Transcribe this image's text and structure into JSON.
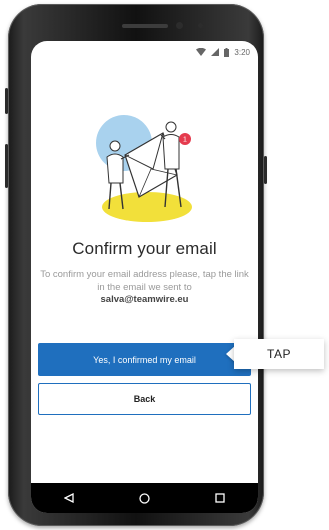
{
  "status_bar": {
    "time": "3:20"
  },
  "confirm_screen": {
    "title": "Confirm your email",
    "instructions": "To confirm your email address please, tap the link in the email we sent to",
    "email": "salva@teamwire.eu",
    "confirm_button_label": "Yes, I confirmed my email",
    "back_button_label": "Back"
  },
  "callout": {
    "label": "TAP"
  },
  "colors": {
    "primary": "#1f6fbe",
    "illustration_blue": "#a9d2ee",
    "illustration_yellow": "#f2e03a",
    "badge_red": "#e53b4e"
  },
  "icons": [
    "wifi-icon",
    "signal-icon",
    "battery-icon",
    "back-triangle-icon",
    "home-circle-icon",
    "recents-square-icon",
    "notification-badge"
  ]
}
